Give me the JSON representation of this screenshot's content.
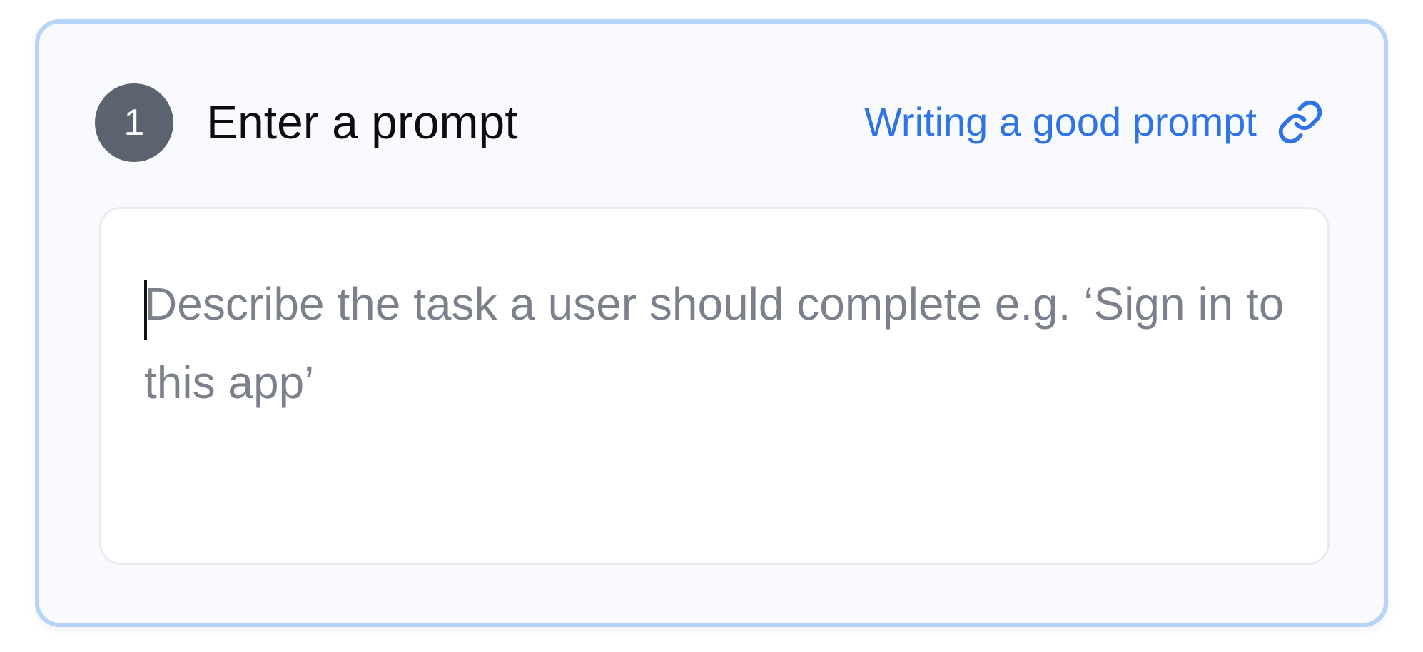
{
  "step": {
    "number": "1",
    "title": "Enter a prompt"
  },
  "help_link": {
    "label": "Writing a good prompt",
    "icon": "link-icon"
  },
  "prompt": {
    "value": "",
    "placeholder": "Describe the task a user should complete e.g. ‘Sign in to this app’"
  },
  "colors": {
    "card_background": "#f9fafd",
    "card_border": "#b6d3f8",
    "badge_background": "#5b6270",
    "link": "#2f74e7",
    "placeholder": "#7b808c"
  }
}
